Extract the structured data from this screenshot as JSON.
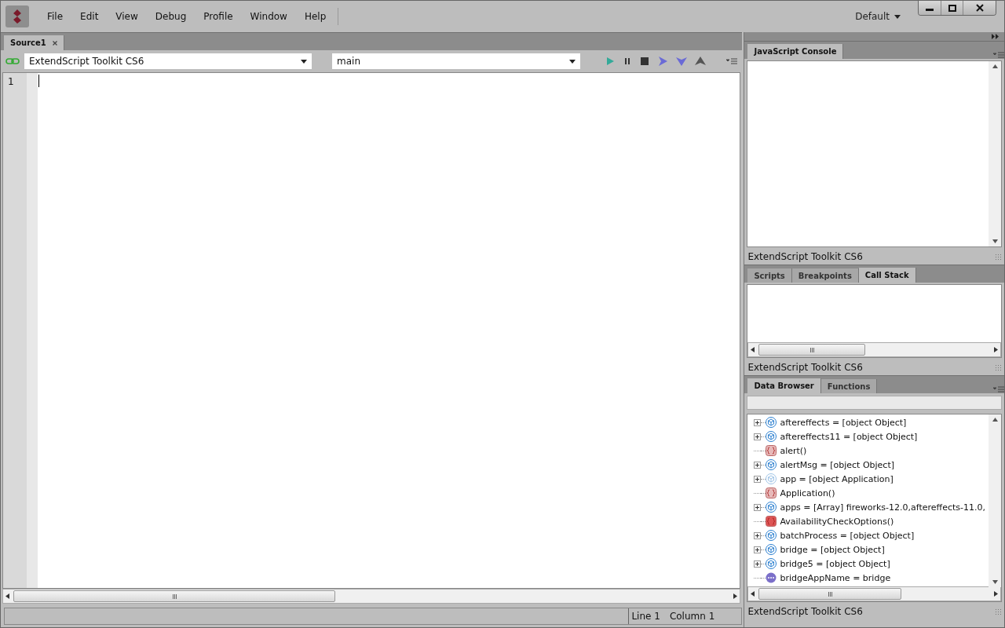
{
  "menu": [
    "File",
    "Edit",
    "View",
    "Debug",
    "Profile",
    "Window",
    "Help"
  ],
  "workspace": "Default",
  "document_tabs": [
    {
      "label": "Source1",
      "selected": true
    }
  ],
  "toolbar": {
    "target": "ExtendScript Toolkit CS6",
    "engine": "main"
  },
  "editor": {
    "line_numbers": [
      "1"
    ]
  },
  "status_bar": {
    "line": "Line 1",
    "column": "Column 1"
  },
  "console": {
    "tabs": [
      {
        "label": "JavaScript Console",
        "selected": true
      }
    ],
    "footer": "ExtendScript Toolkit CS6"
  },
  "debug_panel": {
    "tabs": [
      {
        "label": "Scripts",
        "selected": false
      },
      {
        "label": "Breakpoints",
        "selected": false
      },
      {
        "label": "Call Stack",
        "selected": true
      }
    ],
    "footer": "ExtendScript Toolkit CS6"
  },
  "data_panel": {
    "tabs": [
      {
        "label": "Data Browser",
        "selected": true
      },
      {
        "label": "Functions",
        "selected": false
      }
    ],
    "footer": "ExtendScript Toolkit CS6",
    "items": [
      {
        "text": "aftereffects = [object Object]",
        "kind": "object",
        "expander": true
      },
      {
        "text": "aftereffects11 = [object Object]",
        "kind": "object",
        "expander": true
      },
      {
        "text": "alert()",
        "kind": "function",
        "expander": false
      },
      {
        "text": "alertMsg = [object Object]",
        "kind": "object",
        "expander": true
      },
      {
        "text": "app = [object Application]",
        "kind": "object-dim",
        "expander": true
      },
      {
        "text": "Application()",
        "kind": "function",
        "expander": false
      },
      {
        "text": "apps = [Array] fireworks-12.0,aftereffects-11.0,",
        "kind": "object",
        "expander": true
      },
      {
        "text": "AvailabilityCheckOptions()",
        "kind": "function-strong",
        "expander": false
      },
      {
        "text": "batchProcess = [object Object]",
        "kind": "object",
        "expander": true
      },
      {
        "text": "bridge = [object Object]",
        "kind": "object",
        "expander": true
      },
      {
        "text": "bridge5 = [object Object]",
        "kind": "object",
        "expander": true
      },
      {
        "text": "bridgeAppName = bridge",
        "kind": "value",
        "expander": false
      }
    ]
  }
}
